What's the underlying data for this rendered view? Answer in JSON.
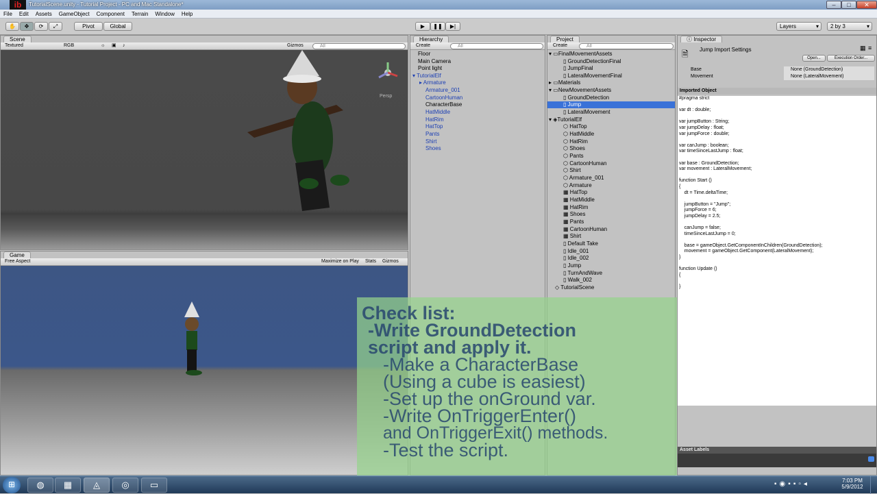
{
  "window": {
    "title": "TutorialScene.unity - Tutorial Project - PC and Mac Standalone*",
    "logo": "ib"
  },
  "menu": [
    "File",
    "Edit",
    "Assets",
    "GameObject",
    "Component",
    "Terrain",
    "Window",
    "Help"
  ],
  "toolbar": {
    "pivot": "Pivot",
    "global": "Global",
    "layers": "Layers",
    "layout": "2 by 3"
  },
  "scene": {
    "tab": "Scene",
    "shading": "Textured",
    "mode": "RGB",
    "gizmos": "Gizmos",
    "search_placeholder": "All",
    "persp": "Persp"
  },
  "game": {
    "tab": "Game",
    "aspect": "Free Aspect",
    "maximize": "Maximize on Play",
    "stats": "Stats",
    "gizmos": "Gizmos"
  },
  "hierarchy": {
    "tab": "Hierarchy",
    "create": "Create",
    "search_placeholder": "All",
    "items": [
      "Floor",
      "Main Camera",
      "Point light",
      "TutorialElf",
      "Armature",
      "Armature_001",
      "CartoonHuman",
      "CharacterBase",
      "HatMiddle",
      "HatRim",
      "HatTop",
      "Pants",
      "Shirt",
      "Shoes"
    ]
  },
  "project": {
    "tab": "Project",
    "create": "Create",
    "search_placeholder": "All",
    "items": [
      "FinalMovementAssets",
      "GroundDetectionFinal",
      "JumpFinal",
      "LateralMovementFinal",
      "Materials",
      "NewMovementAssets",
      "GroundDetection",
      "Jump",
      "LateralMovement",
      "TutorialElf",
      "HatTop",
      "HatMiddle",
      "HatRim",
      "Shoes",
      "Pants",
      "CartoonHuman",
      "Shirt",
      "Armature_001",
      "Armature",
      "HatTop",
      "HatMiddle",
      "HatRim",
      "Shoes",
      "Pants",
      "CartoonHuman",
      "Shirt",
      "Default Take",
      "Idle_001",
      "Idle_002",
      "Jump",
      "TurnAndWave",
      "Walk_002",
      "TutorialScene"
    ]
  },
  "inspector": {
    "tab": "Inspector",
    "title": "Jump Import Settings",
    "open": "Open...",
    "exec_order": "Execution Order...",
    "props": [
      {
        "label": "Base",
        "value": "None (GroundDetection)"
      },
      {
        "label": "Movement",
        "value": "None (LateralMovement)"
      }
    ],
    "section": "Imported Object",
    "code": "#pragma strict\n\nvar dt : double;\n\nvar jumpButton : String;\nvar jumpDelay : float;\nvar jumpForce : double;\n\nvar canJump : boolean;\nvar timeSinceLastJump : float;\n\nvar base : GroundDetection;\nvar movement : LateralMovement;\n\nfunction Start ()\n{\n    dt = Time.deltaTime;\n\n    jumpButton = \"Jump\";\n    jumpForce = 6;\n    jumpDelay = 2.5;\n\n    canJump = false;\n    timeSinceLastJump = 0;\n\n    base = gameObject.GetComponentInChildren(GroundDetection);\n    movement = gameObject.GetComponent(LateralMovement);\n}\n\nfunction Update ()\n{\n\n}",
    "asset_labels": "Asset Labels"
  },
  "checklist": {
    "lines": [
      "Check list:",
      "-Write GroundDetection",
      "script and apply it.",
      "-Make a CharacterBase",
      "(Using a cube is easiest)",
      "-Set up the onGround var.",
      "-Write OnTriggerEnter()",
      "and OnTriggerExit() methods.",
      "-Test the script."
    ]
  },
  "taskbar": {
    "time": "7:03 PM",
    "date": "5/9/2012"
  }
}
